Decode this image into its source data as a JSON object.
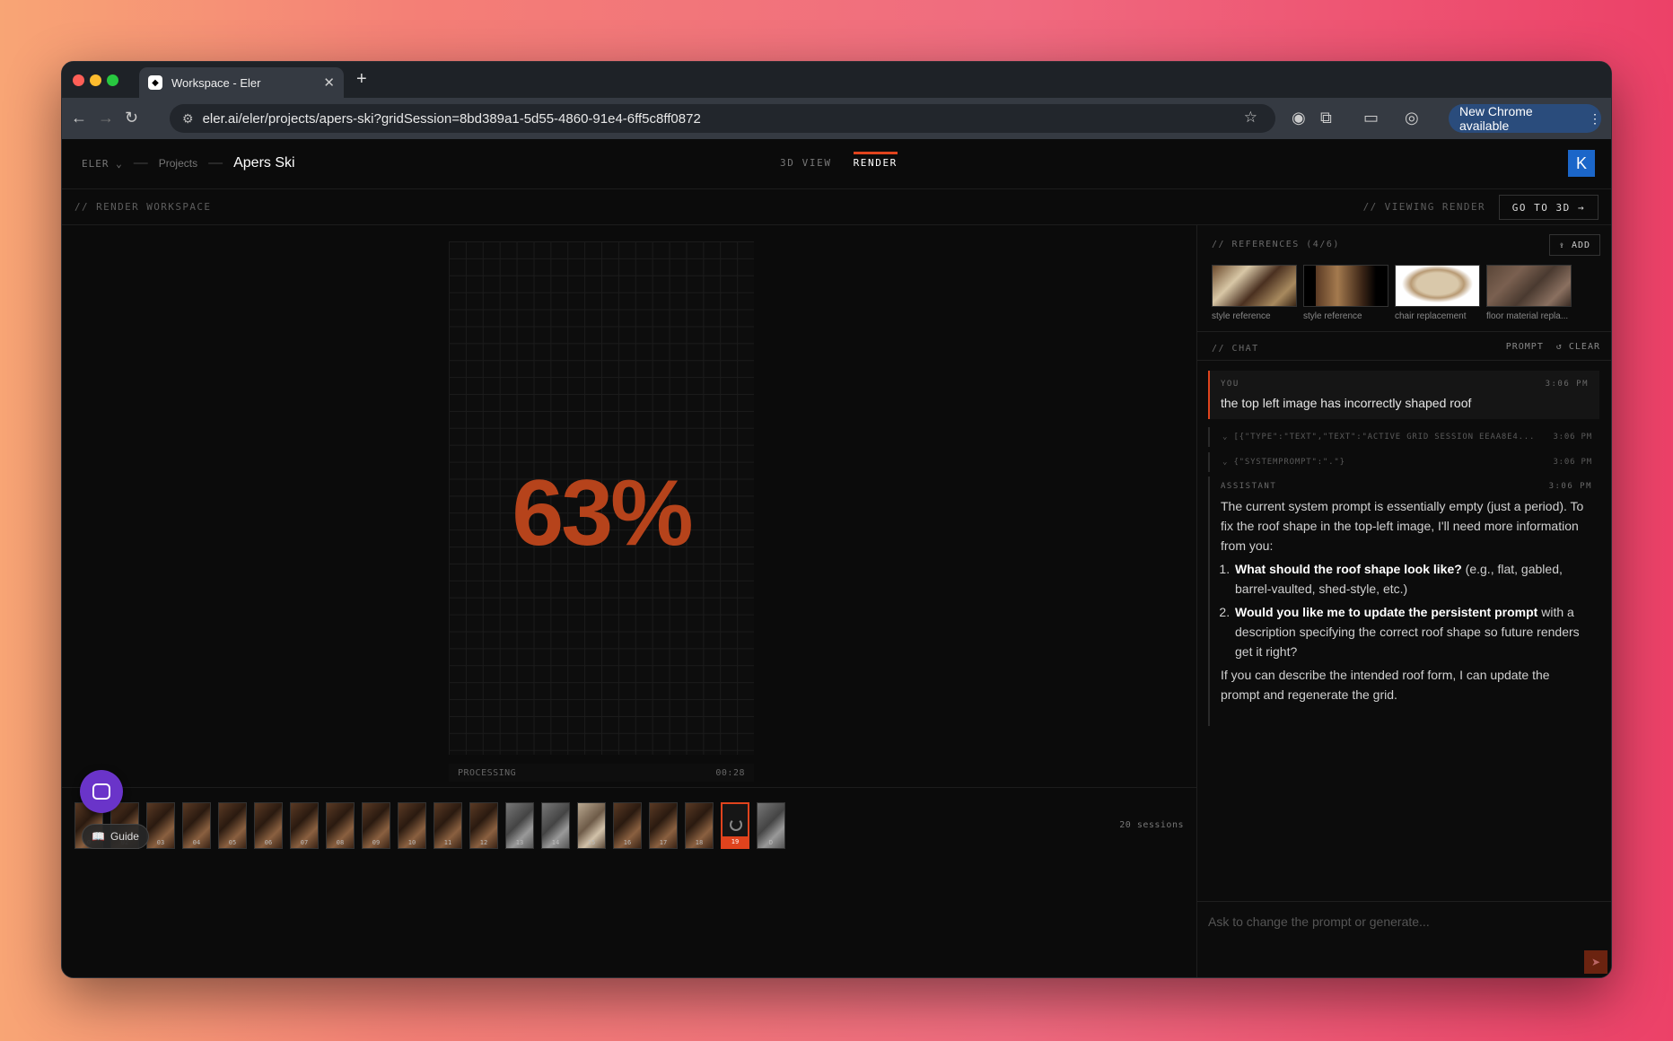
{
  "browser": {
    "tab_title": "Workspace - Eler",
    "url": "eler.ai/eler/projects/apers-ski?gridSession=8bd389a1-5d55-4860-91e4-6ff5c8ff0872",
    "update_label": "New Chrome available"
  },
  "header": {
    "brand": "ELER",
    "projects": "Projects",
    "project_name": "Apers Ski",
    "tabs": [
      "3D VIEW",
      "RENDER"
    ],
    "avatar": "K"
  },
  "subheader": {
    "left": "// RENDER WORKSPACE",
    "right": "// VIEWING RENDER",
    "go_3d": "GO TO 3D →"
  },
  "render": {
    "progress_text": "63%",
    "progress": 0.63,
    "status": "PROCESSING",
    "elapsed": "00:28"
  },
  "sessions": {
    "thumbnails": [
      "0",
      "02",
      "03",
      "04",
      "05",
      "06",
      "07",
      "08",
      "09",
      "10",
      "11",
      "12",
      "13",
      "14",
      "15",
      "16",
      "17",
      "18",
      "19",
      "D"
    ],
    "selected_index": 18,
    "count_label": "20 sessions",
    "guide_label": "Guide"
  },
  "references": {
    "title": "// REFERENCES (4/6)",
    "add_label": "ADD",
    "items": [
      {
        "caption": "style reference"
      },
      {
        "caption": "style reference"
      },
      {
        "caption": "chair replacement"
      },
      {
        "caption": "floor material repla..."
      }
    ]
  },
  "chat": {
    "title": "// CHAT",
    "prompt_label": "PROMPT",
    "clear_label": "CLEAR",
    "user_msg": {
      "role": "YOU",
      "time": "3:06 PM",
      "text": "the top left image has incorrectly shaped roof"
    },
    "sys_msgs": [
      {
        "text": "[{\"TYPE\":\"TEXT\",\"TEXT\":\"ACTIVE GRID SESSION EEAA8E4...",
        "time": "3:06 PM"
      },
      {
        "text": "{\"SYSTEMPROMPT\":\".\"}",
        "time": "3:06 PM"
      }
    ],
    "assistant": {
      "role": "ASSISTANT",
      "time": "3:06 PM",
      "intro": "The current system prompt is essentially empty (just a period). To fix the roof shape in the top-left image, I'll need more information from you:",
      "q1_bold": "What should the roof shape look like?",
      "q1_rest": " (e.g., flat, gabled, barrel-vaulted, shed-style, etc.)",
      "q2_bold": "Would you like me to update the persistent prompt",
      "q2_rest": " with a description specifying the correct roof shape so future renders get it right?",
      "outro": "If you can describe the intended roof form, I can update the prompt and regenerate the grid."
    },
    "input_placeholder": "Ask to change the prompt or generate..."
  }
}
